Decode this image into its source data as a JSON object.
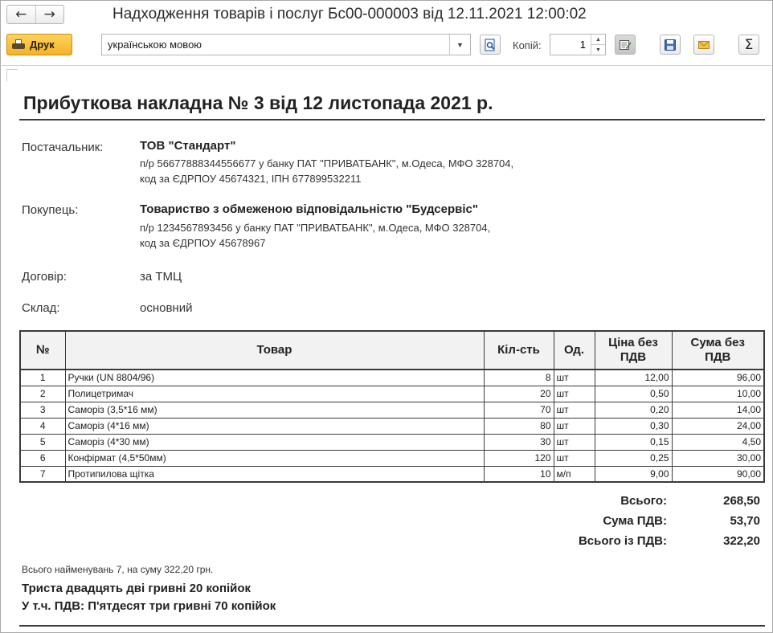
{
  "window": {
    "title": "Надходження товарів і послуг Бс00-000003 від 12.11.2021 12:00:02",
    "nav_back": "←",
    "nav_forward": "→"
  },
  "toolbar": {
    "print_label": "Друк",
    "language_value": "українською мовою",
    "copies_label": "Копій:",
    "copies_value": "1"
  },
  "document": {
    "title": "Прибуткова накладна № 3 від 12 листопада 2021 р.",
    "supplier": {
      "label": "Постачальник:",
      "name": "ТОВ \"Стандарт\"",
      "detail_1": "п/р 56677888344556677 у банку ПАТ \"ПРИВАТБАНК\", м.Одеса, МФО 328704,",
      "detail_2": "код за ЄДРПОУ 45674321, ІПН 677899532211"
    },
    "buyer": {
      "label": "Покупець:",
      "name": "Товариство з обмеженою відповідальністю \"Будсервіс\"",
      "detail_1": "п/р 1234567893456 у банку ПАТ \"ПРИВАТБАНК\", м.Одеса, МФО 328704,",
      "detail_2": "код за ЄДРПОУ 45678967"
    },
    "contract": {
      "label": "Договір:",
      "value": "за ТМЦ"
    },
    "warehouse": {
      "label": "Склад:",
      "value": "основний"
    },
    "table": {
      "headers": [
        "№",
        "Товар",
        "Кіл-сть",
        "Од.",
        "Ціна без ПДВ",
        "Сума без ПДВ"
      ],
      "rows": [
        [
          "1",
          "Ручки (UN 8804/96)",
          "8",
          "шт",
          "12,00",
          "96,00"
        ],
        [
          "2",
          "Полицетримач",
          "20",
          "шт",
          "0,50",
          "10,00"
        ],
        [
          "3",
          "Саморіз (3,5*16 мм)",
          "70",
          "шт",
          "0,20",
          "14,00"
        ],
        [
          "4",
          "Саморіз (4*16 мм)",
          "80",
          "шт",
          "0,30",
          "24,00"
        ],
        [
          "5",
          "Саморіз (4*30 мм)",
          "30",
          "шт",
          "0,15",
          "4,50"
        ],
        [
          "6",
          "Конфірмат (4,5*50мм)",
          "120",
          "шт",
          "0,25",
          "30,00"
        ],
        [
          "7",
          "Протипилова щітка",
          "10",
          "м/п",
          "9,00",
          "90,00"
        ]
      ]
    },
    "totals": {
      "total_label": "Всього:",
      "total_value": "268,50",
      "vat_label": "Сума ПДВ:",
      "vat_value": "53,70",
      "total_vat_label": "Всього із ПДВ:",
      "total_vat_value": "322,20"
    },
    "summary_line": "Всього найменувань 7, на суму 322,20 грн.",
    "amount_words": "Триста двадцять дві гривні 20 копійок",
    "vat_words": "У т.ч. ПДВ: П'ятдесят три гривні 70 копійок"
  }
}
